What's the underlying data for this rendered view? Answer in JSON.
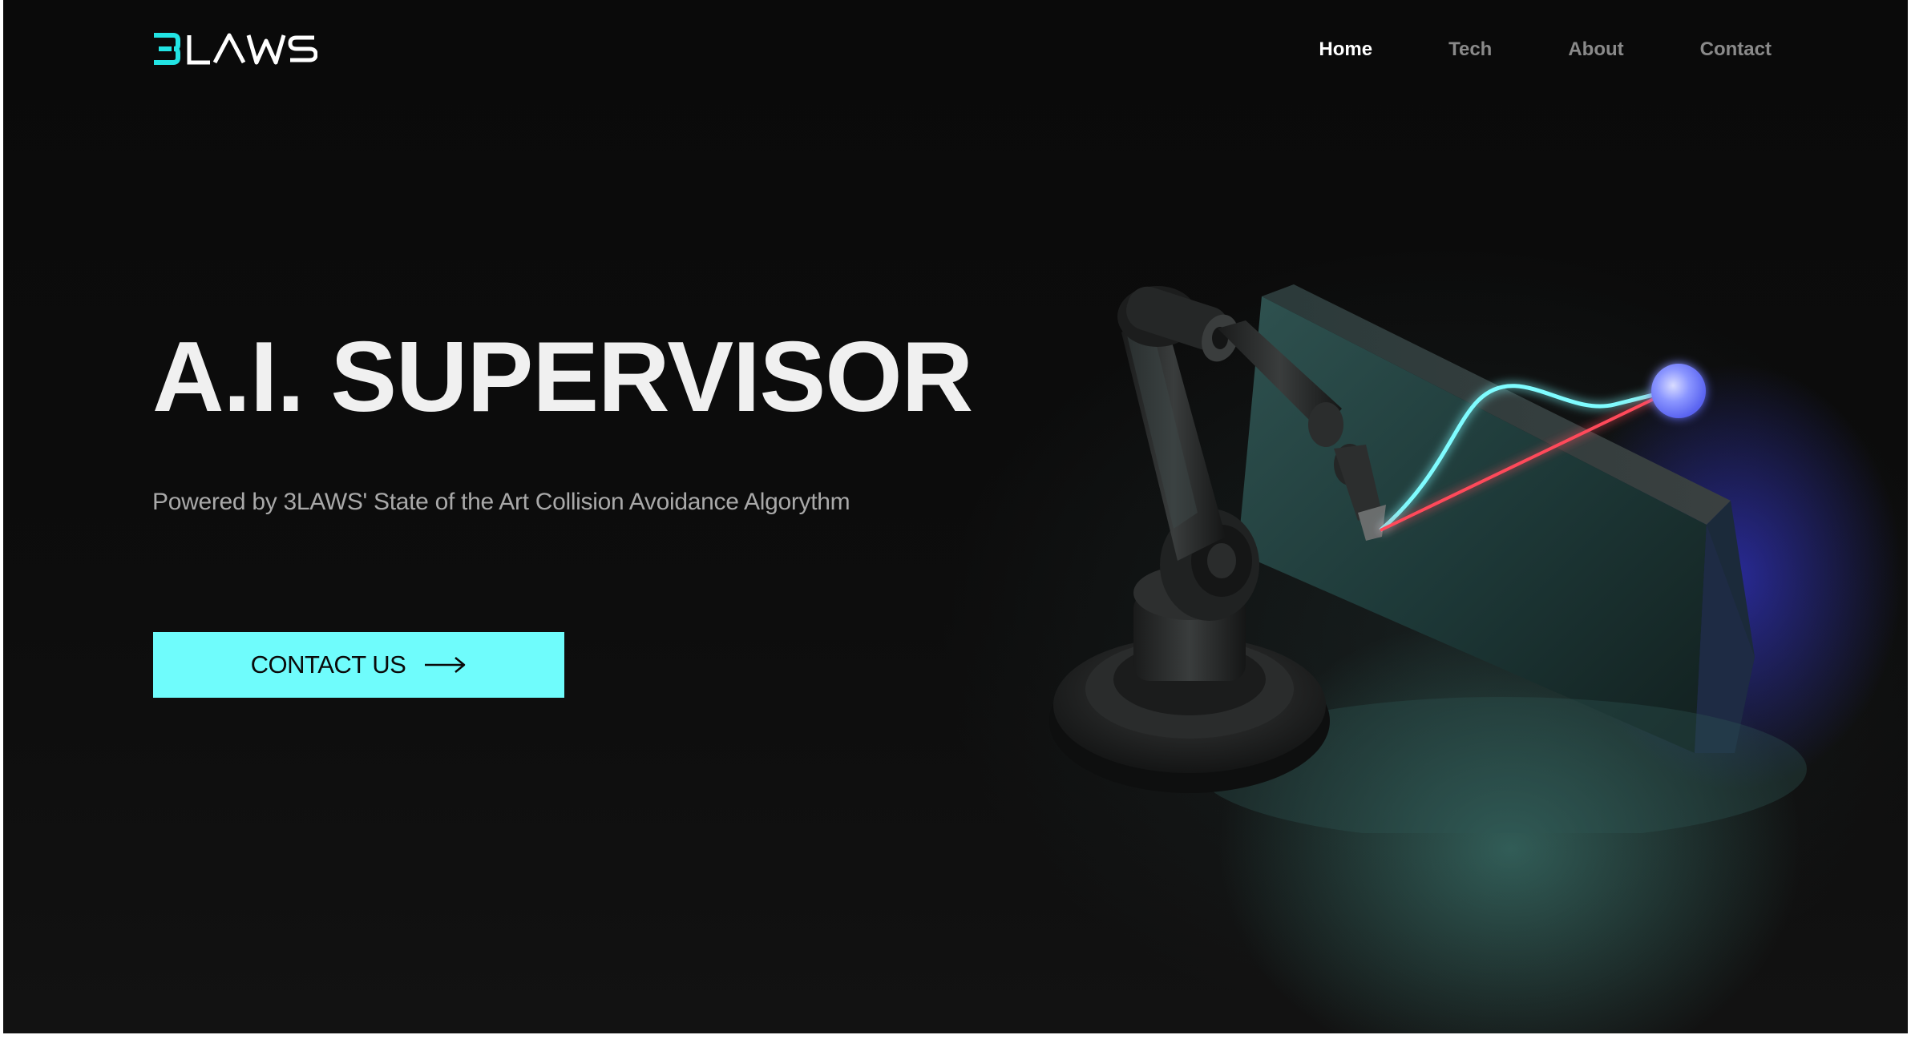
{
  "header": {
    "logo_text": "3LAWS",
    "nav": [
      {
        "label": "Home",
        "active": true
      },
      {
        "label": "Tech",
        "active": false
      },
      {
        "label": "About",
        "active": false
      },
      {
        "label": "Contact",
        "active": false
      }
    ]
  },
  "hero": {
    "title": "A.I. SUPERVISOR",
    "subtitle": "Powered by 3LAWS' State of the Art Collision Avoidance Algorythm",
    "cta_label": "CONTACT US",
    "cta_icon": "arrow-right-icon",
    "illustration": "robot-arm-illustration"
  },
  "colors": {
    "accent": "#6ffcfc",
    "background": "#0b0b0b",
    "nav_active": "#ffffff",
    "nav_inactive": "#8a8a8a"
  }
}
